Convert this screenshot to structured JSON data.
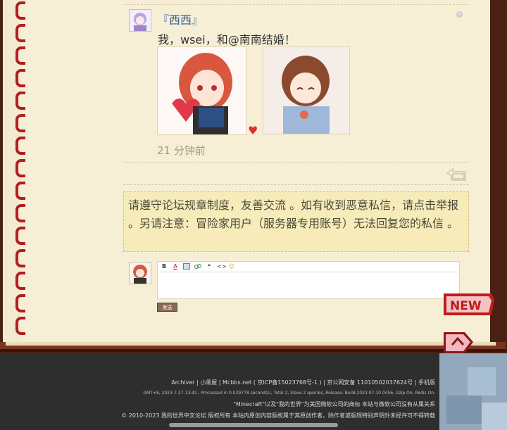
{
  "post": {
    "username": "『西西』",
    "text": "我，wsei，和@南南结婚！",
    "time": "21 分钟前",
    "heart": "♥"
  },
  "notice": {
    "text": "请遵守论坛规章制度，友善交流 。如有收到恶意私信，请点击举报 。另请注意：冒险家用户（服务器专用账号）无法回复您的私信 。"
  },
  "editor": {
    "tools": [
      "B",
      "A",
      "img",
      "link",
      "❝",
      "<>",
      "☺"
    ],
    "send_label": "发送"
  },
  "badges": {
    "new_label": "NEW"
  },
  "footer": {
    "line1": "Archiver | 小黑屋 | Mcbbs.net ( 京ICP备15023768号-1 ) | 京公网安备 11010502037624号 | 手机版",
    "line2": "GMT+8, 2023-7-27 13:42 , Processed in 0.029778 second(s), Total 2, Slave 2 queries, Release: Build.2023.07.10 0456, Gzip On, Redis On.",
    "line3": "\"Minecraft\"以及\"我的世界\"为美国微软公司的商标 本站与微软公司没有从属关系",
    "line4": "© 2010-2023 我的世界中文论坛 版权所有 本站内原创内容版权属于其原创作者，除作者或版规特别声明外未经许可不得转载"
  },
  "colors": {
    "book_frame": "#4a1f14",
    "page": "#f6efd6",
    "rings": "#b11f1f",
    "notice_bg": "#f6ebb9",
    "username": "#2f5d94",
    "footer_bg": "#2e2e2e"
  }
}
